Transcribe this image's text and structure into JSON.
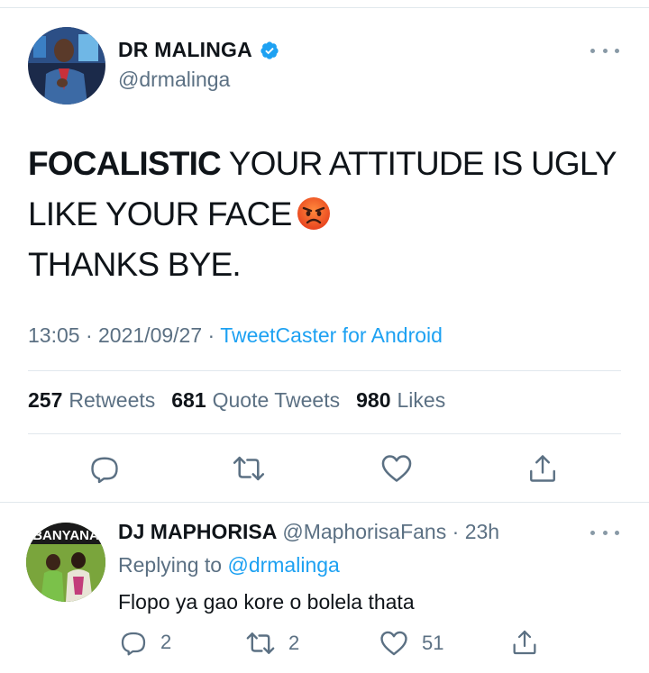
{
  "main_tweet": {
    "author_name": "DR MALINGA",
    "author_handle": "@drmalinga",
    "text_bold": "FOCALISTIC",
    "text_line1_rest": " YOUR ATTITUDE IS UGLY",
    "text_line2": "LIKE YOUR FACE",
    "text_line3": "THANKS BYE.",
    "time": "13:05",
    "date": "2021/09/27",
    "separator": "·",
    "source": "TweetCaster for Android",
    "retweets_count": "257",
    "retweets_label": "Retweets",
    "quotes_count": "681",
    "quotes_label": "Quote Tweets",
    "likes_count": "980",
    "likes_label": "Likes"
  },
  "reply": {
    "author_name": "DJ MAPHORISA",
    "author_handle": "@MaphorisaFans",
    "time_ago": "23h",
    "replying_prefix": "Replying to",
    "replying_to": "@drmalinga",
    "avatar_banner_text": "BANYANA",
    "text": "Flopo ya gao kore o bolela thata",
    "reply_count": "2",
    "retweet_count": "2",
    "like_count": "51"
  },
  "icons": {
    "verified": "verified-badge-icon",
    "more": "more-dots-icon",
    "reply": "reply-bubble-icon",
    "retweet": "retweet-icon",
    "like": "heart-icon",
    "share": "share-icon",
    "emoji": "angry-face-emoji"
  },
  "colors": {
    "accent": "#1da1f2",
    "secondary_text": "#5b7083",
    "icon_gray": "#5b7083",
    "divider": "#e1e8ed"
  }
}
